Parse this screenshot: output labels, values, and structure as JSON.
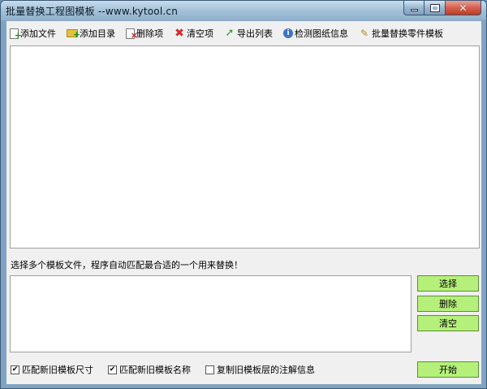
{
  "window": {
    "title": "批量替换工程图模板 --www.kytool.cn",
    "controls": {
      "minimize_icon": "minimize-icon",
      "maximize_icon": "maximize-icon",
      "close_icon": "close-icon"
    }
  },
  "toolbar": {
    "items": [
      {
        "label": "添加文件",
        "icon": "add-file-icon"
      },
      {
        "label": "添加目录",
        "icon": "add-folder-icon"
      },
      {
        "label": "删除项",
        "icon": "delete-item-icon"
      },
      {
        "label": "清空项",
        "icon": "clear-icon"
      },
      {
        "label": "导出列表",
        "icon": "export-arrow-icon"
      },
      {
        "label": "检测图纸信息",
        "icon": "info-icon"
      },
      {
        "label": "批量替换零件模板",
        "icon": "replace-template-icon"
      }
    ]
  },
  "main": {
    "hint": "选择多个模板文件，程序自动匹配最合适的一个用来替换！"
  },
  "buttons": {
    "select": "选择",
    "delete": "删除",
    "clear": "清空",
    "start": "开始"
  },
  "options": [
    {
      "label": "匹配新旧模板尺寸",
      "checked": true
    },
    {
      "label": "匹配新旧模板名称",
      "checked": true
    },
    {
      "label": "复制旧模板层的注解信息",
      "checked": false
    }
  ],
  "colors": {
    "action_button": "#b5f07a",
    "title_bar": "#a4c1d9",
    "close_button": "#d6604d"
  }
}
